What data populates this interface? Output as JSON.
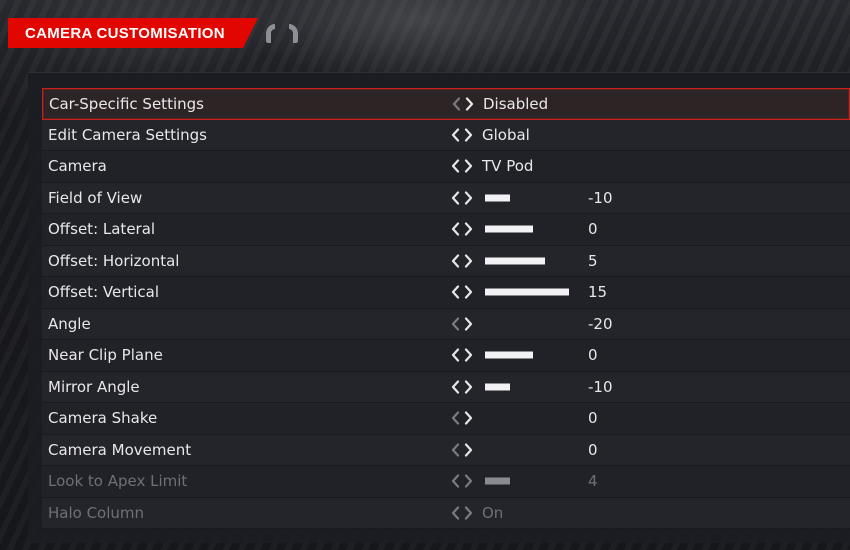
{
  "header": {
    "title": "CAMERA CUSTOMISATION",
    "accent_color": "#e10600",
    "icons": [
      "left-bumper-icon",
      "right-bumper-icon"
    ]
  },
  "settings": [
    {
      "label": "Car-Specific Settings",
      "value": "Disabled",
      "left_enabled": false,
      "right_enabled": true,
      "selected": true,
      "disabled": false
    },
    {
      "label": "Edit Camera Settings",
      "value": "Global",
      "left_enabled": true,
      "right_enabled": true,
      "selected": false,
      "disabled": false
    },
    {
      "label": "Camera",
      "value": "TV Pod",
      "left_enabled": true,
      "right_enabled": true,
      "selected": false,
      "disabled": false
    },
    {
      "label": "Field of View",
      "number": "-10",
      "bar_fraction": 0.3,
      "left_enabled": true,
      "right_enabled": true,
      "selected": false,
      "disabled": false
    },
    {
      "label": "Offset: Lateral",
      "number": "0",
      "bar_fraction": 0.57,
      "left_enabled": true,
      "right_enabled": true,
      "selected": false,
      "disabled": false
    },
    {
      "label": "Offset: Horizontal",
      "number": "5",
      "bar_fraction": 0.71,
      "left_enabled": true,
      "right_enabled": true,
      "selected": false,
      "disabled": false
    },
    {
      "label": "Offset: Vertical",
      "number": "15",
      "bar_fraction": 1.0,
      "left_enabled": true,
      "right_enabled": true,
      "selected": false,
      "disabled": false
    },
    {
      "label": "Angle",
      "number": "-20",
      "bar_fraction": 0,
      "left_enabled": false,
      "right_enabled": true,
      "selected": false,
      "disabled": false
    },
    {
      "label": "Near Clip Plane",
      "number": "0",
      "bar_fraction": 0.57,
      "left_enabled": true,
      "right_enabled": true,
      "selected": false,
      "disabled": false
    },
    {
      "label": "Mirror Angle",
      "number": "-10",
      "bar_fraction": 0.3,
      "left_enabled": true,
      "right_enabled": true,
      "selected": false,
      "disabled": false
    },
    {
      "label": "Camera Shake",
      "number": "0",
      "bar_fraction": 0,
      "left_enabled": false,
      "right_enabled": true,
      "selected": false,
      "disabled": false
    },
    {
      "label": "Camera Movement",
      "number": "0",
      "bar_fraction": 0,
      "left_enabled": false,
      "right_enabled": true,
      "selected": false,
      "disabled": false
    },
    {
      "label": "Look to Apex Limit",
      "number": "4",
      "bar_fraction": 0.3,
      "left_enabled": false,
      "right_enabled": false,
      "selected": false,
      "disabled": true
    },
    {
      "label": "Halo Column",
      "value": "On",
      "left_enabled": false,
      "right_enabled": false,
      "selected": false,
      "disabled": true
    }
  ]
}
